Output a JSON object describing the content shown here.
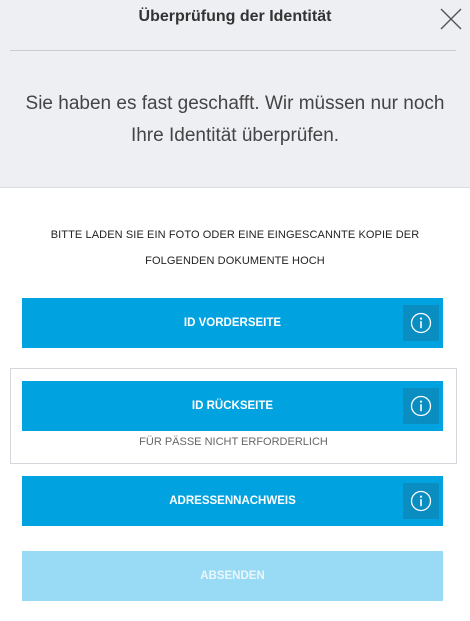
{
  "header": {
    "title": "Überprüfung der Identität",
    "message": "Sie haben es fast geschafft. Wir müssen nur noch Ihre Identität überprüfen."
  },
  "instructions": {
    "line1": "BITTE LADEN SIE EIN FOTO ODER EINE EINGESCANNTE KOPIE DER",
    "line2": "FOLGENDEN DOKUMENTE HOCH"
  },
  "documents": [
    {
      "label": "ID VORDERSEITE"
    },
    {
      "label": "ID RÜCKSEITE",
      "note": "FÜR PÄSSE NICHT ERFORDERLICH"
    },
    {
      "label": "ADRESSENNACHWEIS"
    }
  ],
  "submit": {
    "label": "ABSENDEN",
    "state": "disabled"
  },
  "colors": {
    "header_bg": "#eeeff3",
    "button_blue": "#00a2df",
    "info_box": "#0a8dc0",
    "submit_disabled": "#99dbf4"
  },
  "icons": {
    "close": "close-icon",
    "info": "info-icon"
  }
}
